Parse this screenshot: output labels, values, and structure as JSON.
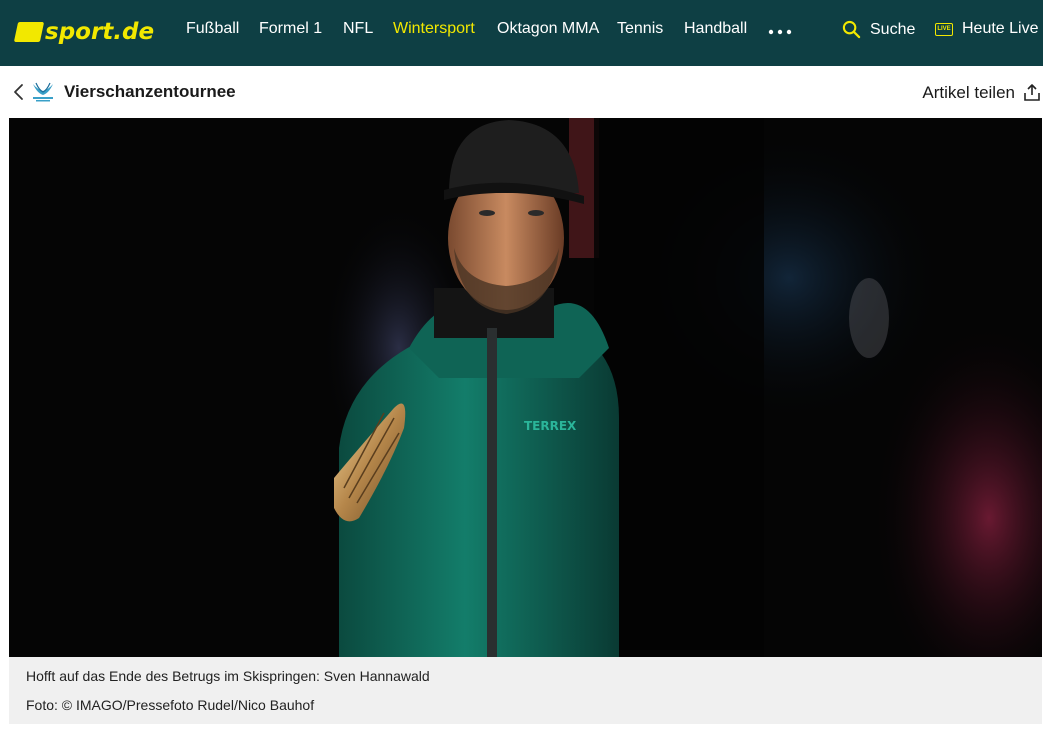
{
  "brand": {
    "logo_text": "sport.de",
    "accent": "#f2e800",
    "nav_bg": "#0e3f44"
  },
  "nav": {
    "items": [
      {
        "label": "Fußball"
      },
      {
        "label": "Formel 1"
      },
      {
        "label": "NFL"
      },
      {
        "label": "Wintersport",
        "active": true
      },
      {
        "label": "Oktagon MMA"
      },
      {
        "label": "Tennis"
      },
      {
        "label": "Handball"
      }
    ],
    "more_icon": "more-horizontal-icon",
    "search_label": "Suche",
    "live_badge": "LIVE",
    "live_label": "Heute Live"
  },
  "subheader": {
    "back_icon": "chevron-left-icon",
    "section_logo": "vierschanzentournee-logo",
    "title": "Vierschanzentournee",
    "share_label": "Artikel teilen",
    "share_icon": "share-icon"
  },
  "image": {
    "caption": "Hofft auf das Ende des Betrugs im Skispringen: Sven Hannawald",
    "credit": "Foto: © IMAGO/Pressefoto Rudel/Nico Bauhof",
    "cap_logo_text": "TERREX"
  }
}
